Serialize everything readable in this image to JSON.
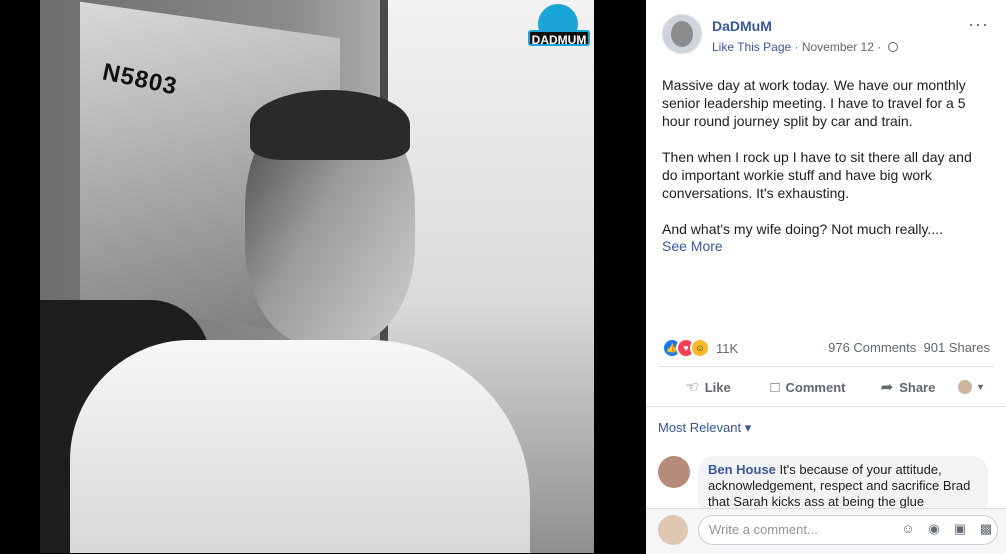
{
  "photo": {
    "plate_text": "N5803",
    "logo_text": "DADMUM"
  },
  "post": {
    "page_name": "DaDMuM",
    "like_page": "Like This Page",
    "separator": " · ",
    "date": "November 12",
    "date_suffix": " · ",
    "more_label": "···",
    "paragraphs": [
      "Massive day at work today. We have our monthly senior leadership meeting. I have to travel for a 5 hour round journey split by car and train.",
      "Then when I rock up I have to sit there all day and do important workie stuff and have big work conversations. It's exhausting.",
      "And what's my wife doing? Not much really...."
    ],
    "see_more": "See More"
  },
  "stats": {
    "reactions_count": "11K",
    "comments": "976 Comments",
    "shares": "901 Shares"
  },
  "actions": {
    "like": "Like",
    "comment": "Comment",
    "share": "Share"
  },
  "filter": {
    "label": "Most Relevant",
    "caret": "▾"
  },
  "comment": {
    "author": "Ben House",
    "text": " It's because of your attitude, acknowledgement, respect and sacrifice Brad that Sarah kicks ass at being the glue"
  },
  "composer": {
    "placeholder": "Write a comment..."
  },
  "colors": {
    "link": "#385898",
    "like": "#1877f2",
    "love": "#f33e58",
    "haha": "#f7b928"
  },
  "icons": [
    "like-icon",
    "love-icon",
    "haha-icon",
    "comment-icon",
    "share-icon",
    "globe-icon",
    "emoji-icon",
    "camera-icon",
    "gif-icon",
    "sticker-icon"
  ]
}
